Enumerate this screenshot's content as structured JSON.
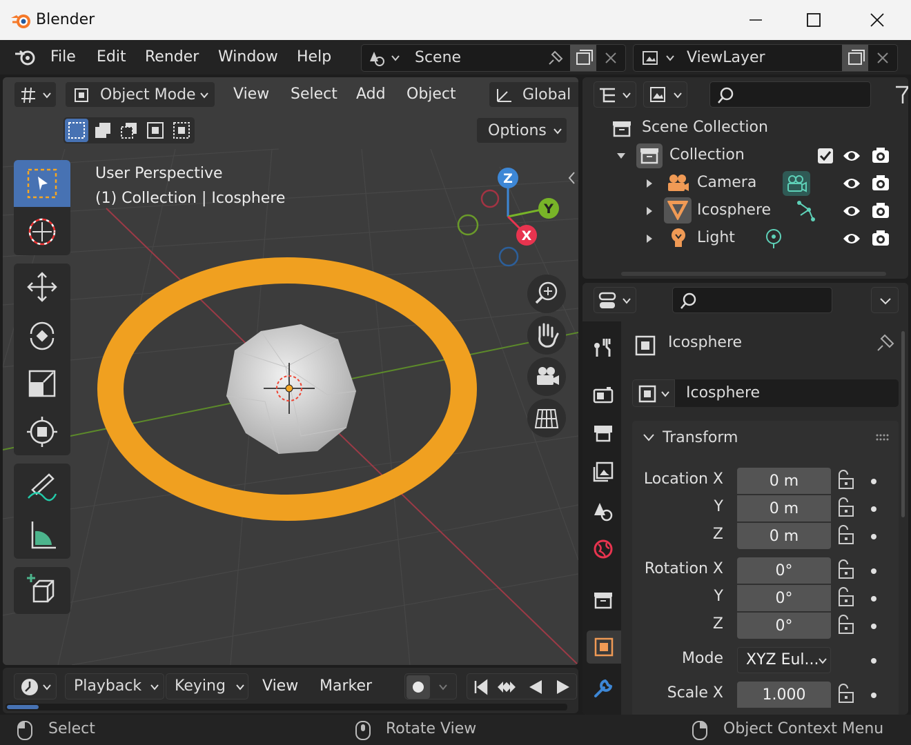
{
  "window": {
    "title": "Blender"
  },
  "menubar": {
    "items": [
      "File",
      "Edit",
      "Render",
      "Window",
      "Help"
    ],
    "scene": "Scene",
    "view_layer": "ViewLayer"
  },
  "viewport": {
    "mode": "Object Mode",
    "menus": [
      "View",
      "Select",
      "Add",
      "Object"
    ],
    "orientation": "Global",
    "options": "Options",
    "info_line1": "User Perspective",
    "info_line2": "(1) Collection | Icosphere",
    "gizmo": {
      "z": "Z",
      "y": "Y",
      "x": "X"
    }
  },
  "outliner": {
    "scene_collection": "Scene Collection",
    "collection": "Collection",
    "items": [
      "Camera",
      "Icosphere",
      "Light"
    ]
  },
  "properties": {
    "object_name": "Icosphere",
    "datablock_name": "Icosphere",
    "panel": "Transform",
    "location": {
      "label": "Location X",
      "x": "0 m",
      "y": "0 m",
      "z": "0 m"
    },
    "rotation": {
      "label": "Rotation X",
      "x": "0°",
      "y": "0°",
      "z": "0°"
    },
    "axis_y": "Y",
    "axis_z": "Z",
    "mode_label": "Mode",
    "mode_value": "XYZ Eul...",
    "scale": {
      "label": "Scale X",
      "x": "1.000"
    }
  },
  "timeline": {
    "menus": [
      "Playback",
      "Keying",
      "View",
      "Marker"
    ]
  },
  "statusbar": {
    "left": "Select",
    "middle": "Rotate View",
    "right": "Object Context Menu"
  },
  "colors": {
    "accent": "#f5a623",
    "selection_blue": "#4772b3",
    "x_axis": "#e8344f",
    "y_axis": "#78b428",
    "z_axis": "#3d87d6"
  }
}
